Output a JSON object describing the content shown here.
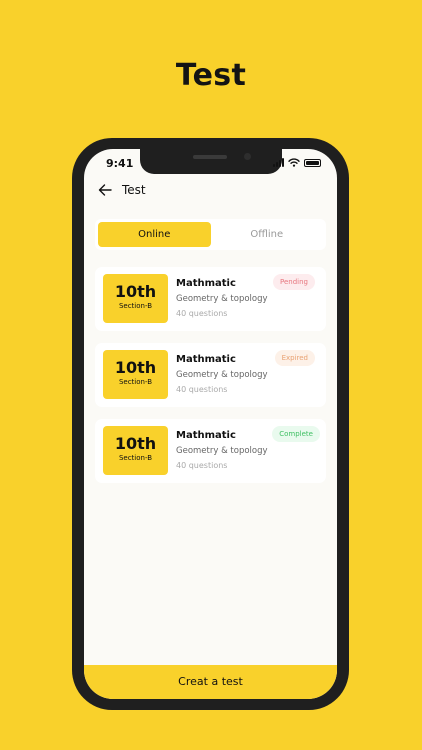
{
  "headline": "Test",
  "status": {
    "time": "9:41"
  },
  "appbar": {
    "title": "Test",
    "back_icon": "arrow-left-icon"
  },
  "tabs": [
    {
      "label": "Online",
      "active": true
    },
    {
      "label": "Offline",
      "active": false
    }
  ],
  "cards": [
    {
      "grade": "10th",
      "section": "Section-B",
      "subject": "Mathmatic",
      "topic": "Geometry & topology",
      "questions": "40 questions",
      "status": "Pending"
    },
    {
      "grade": "10th",
      "section": "Section-B",
      "subject": "Mathmatic",
      "topic": "Geometry & topology",
      "questions": "40 questions",
      "status": "Expired"
    },
    {
      "grade": "10th",
      "section": "Section-B",
      "subject": "Mathmatic",
      "topic": "Geometry & topology",
      "questions": "40 questions",
      "status": "Complete"
    }
  ],
  "bottom_button": "Creat a test",
  "colors": {
    "accent": "#F9D12B",
    "pending": "#E7767F",
    "expired": "#E9A273",
    "complete": "#3FBF63"
  }
}
